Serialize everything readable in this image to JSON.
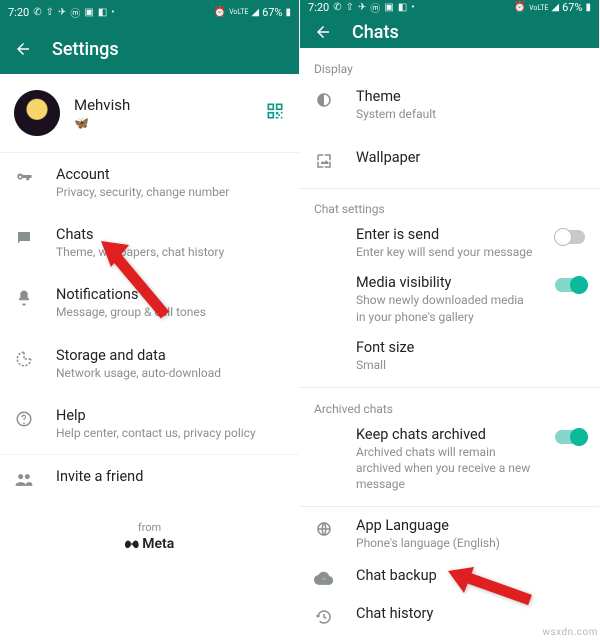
{
  "status": {
    "time": "7:20",
    "battery": "67%"
  },
  "left": {
    "title": "Settings",
    "profile": {
      "name": "Mehvish",
      "emoji": "🦋"
    },
    "rows": {
      "account": {
        "title": "Account",
        "sub": "Privacy, security, change number"
      },
      "chats": {
        "title": "Chats",
        "sub": "Theme, wallpapers, chat history"
      },
      "notif": {
        "title": "Notifications",
        "sub": "Message, group & call tones"
      },
      "storage": {
        "title": "Storage and data",
        "sub": "Network usage, auto-download"
      },
      "help": {
        "title": "Help",
        "sub": "Help center, contact us, privacy policy"
      },
      "invite": {
        "title": "Invite a friend"
      }
    },
    "from": "from",
    "brand": "Meta"
  },
  "right": {
    "title": "Chats",
    "sections": {
      "display": "Display",
      "chat_settings": "Chat settings",
      "archived": "Archived chats"
    },
    "rows": {
      "theme": {
        "title": "Theme",
        "sub": "System default"
      },
      "wallpaper": {
        "title": "Wallpaper"
      },
      "enter": {
        "title": "Enter is send",
        "sub": "Enter key will send your message"
      },
      "media": {
        "title": "Media visibility",
        "sub": "Show newly downloaded media in your phone's gallery"
      },
      "font": {
        "title": "Font size",
        "sub": "Small"
      },
      "keep": {
        "title": "Keep chats archived",
        "sub": "Archived chats will remain archived when you receive a new message"
      },
      "lang": {
        "title": "App Language",
        "sub": "Phone's language (English)"
      },
      "backup": {
        "title": "Chat backup"
      },
      "history": {
        "title": "Chat history"
      }
    }
  },
  "watermark": "wsxdn.com"
}
